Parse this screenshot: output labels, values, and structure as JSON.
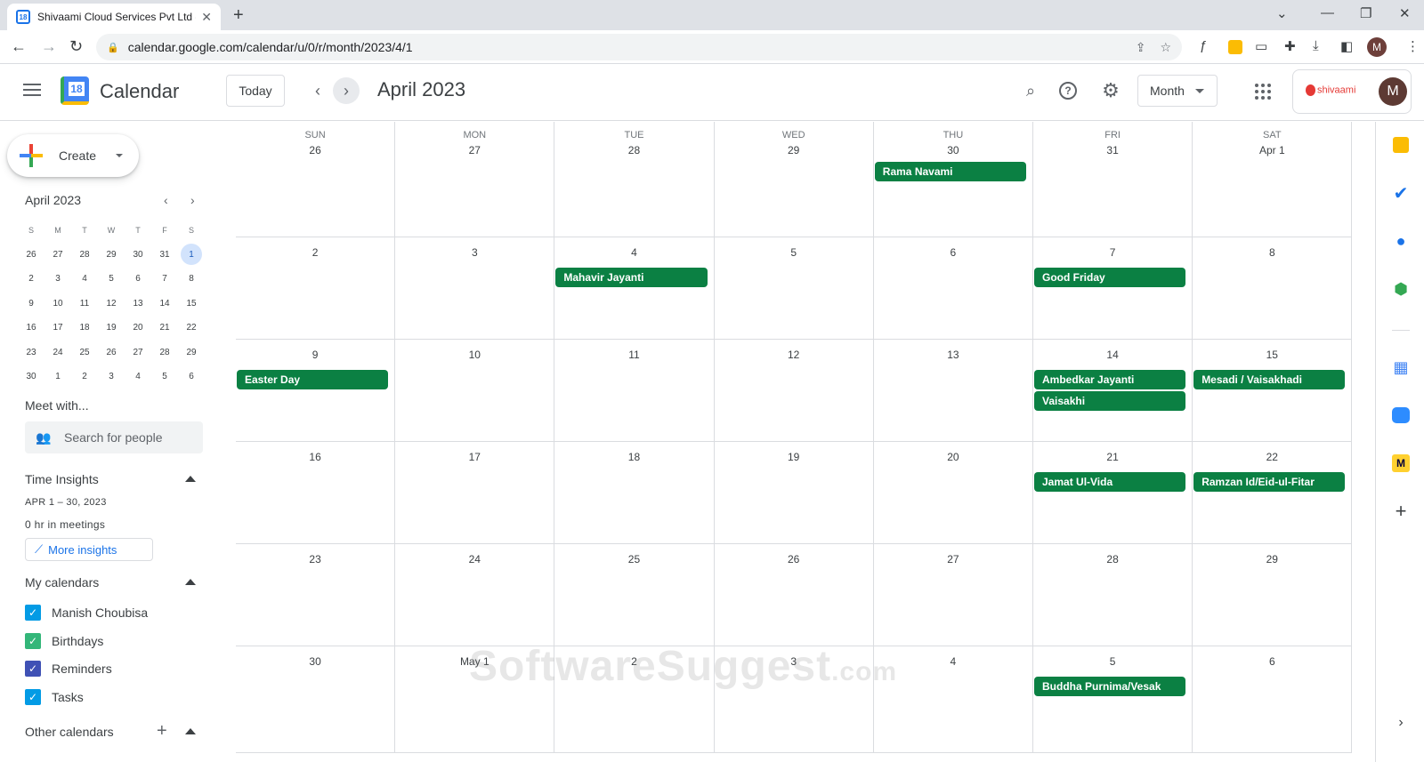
{
  "browser": {
    "tab_title": "Shivaami Cloud Services Pvt Ltd -",
    "tab_favicon": "18",
    "url": "calendar.google.com/calendar/u/0/r/month/2023/4/1",
    "profile_initial": "M"
  },
  "header": {
    "app_name": "Calendar",
    "logo_text": "18",
    "today_label": "Today",
    "period": "April 2023",
    "view_label": "Month",
    "org_name": "shivaami",
    "avatar_initial": "M"
  },
  "sidebar": {
    "create_label": "Create",
    "mini": {
      "title": "April 2023",
      "weekday_heads": [
        "S",
        "M",
        "T",
        "W",
        "T",
        "F",
        "S"
      ],
      "days": [
        "26",
        "27",
        "28",
        "29",
        "30",
        "31",
        "1",
        "2",
        "3",
        "4",
        "5",
        "6",
        "7",
        "8",
        "9",
        "10",
        "11",
        "12",
        "13",
        "14",
        "15",
        "16",
        "17",
        "18",
        "19",
        "20",
        "21",
        "22",
        "23",
        "24",
        "25",
        "26",
        "27",
        "28",
        "29",
        "30",
        "1",
        "2",
        "3",
        "4",
        "5",
        "6"
      ],
      "selected_index": 6
    },
    "meet_with": "Meet with...",
    "search_people_placeholder": "Search for people",
    "time_insights": "Time Insights",
    "insights_range": "APR 1 – 30, 2023",
    "insights_meetings": "0 hr in meetings",
    "more_insights": "More insights",
    "my_calendars_title": "My calendars",
    "my_calendars": [
      {
        "name": "Manish Choubisa",
        "color": "#039be5"
      },
      {
        "name": "Birthdays",
        "color": "#33b679"
      },
      {
        "name": "Reminders",
        "color": "#3f51b5"
      },
      {
        "name": "Tasks",
        "color": "#039be5"
      }
    ],
    "other_calendars_title": "Other calendars"
  },
  "month": {
    "weekdays": [
      "SUN",
      "MON",
      "TUE",
      "WED",
      "THU",
      "FRI",
      "SAT"
    ],
    "weeks": [
      [
        "26",
        "27",
        "28",
        "29",
        "30",
        "31",
        "Apr 1"
      ],
      [
        "2",
        "3",
        "4",
        "5",
        "6",
        "7",
        "8"
      ],
      [
        "9",
        "10",
        "11",
        "12",
        "13",
        "14",
        "15"
      ],
      [
        "16",
        "17",
        "18",
        "19",
        "20",
        "21",
        "22"
      ],
      [
        "23",
        "24",
        "25",
        "26",
        "27",
        "28",
        "29"
      ],
      [
        "30",
        "May 1",
        "2",
        "3",
        "4",
        "5",
        "6"
      ]
    ],
    "events": [
      {
        "week": 0,
        "day": 4,
        "slot": 0,
        "title": "Rama Navami"
      },
      {
        "week": 1,
        "day": 2,
        "slot": 0,
        "title": "Mahavir Jayanti"
      },
      {
        "week": 1,
        "day": 5,
        "slot": 0,
        "title": "Good Friday"
      },
      {
        "week": 2,
        "day": 0,
        "slot": 0,
        "title": "Easter Day"
      },
      {
        "week": 2,
        "day": 5,
        "slot": 0,
        "title": "Ambedkar Jayanti"
      },
      {
        "week": 2,
        "day": 5,
        "slot": 1,
        "title": "Vaisakhi"
      },
      {
        "week": 2,
        "day": 6,
        "slot": 0,
        "title": "Mesadi / Vaisakhadi"
      },
      {
        "week": 3,
        "day": 5,
        "slot": 0,
        "title": "Jamat Ul-Vida"
      },
      {
        "week": 3,
        "day": 6,
        "slot": 0,
        "title": "Ramzan Id/Eid-ul-Fitar"
      },
      {
        "week": 5,
        "day": 5,
        "slot": 0,
        "title": "Buddha Purnima/Vesak"
      }
    ],
    "event_color": "#0b8043"
  },
  "watermark": {
    "main": "SoftwareSuggest",
    "suffix": ".com"
  }
}
